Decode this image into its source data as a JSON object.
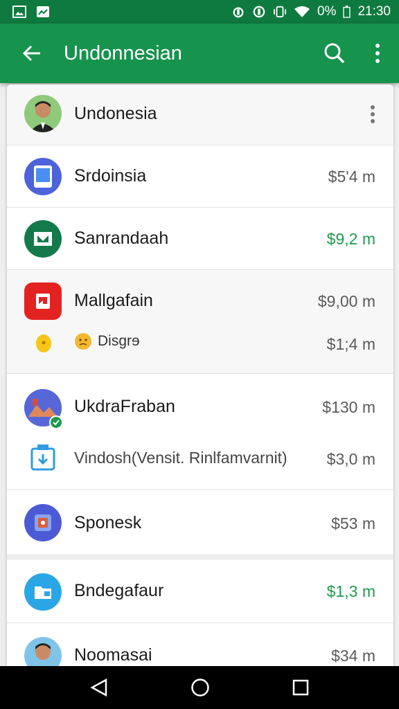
{
  "status_bar": {
    "battery_text": "0%",
    "time": "21:30"
  },
  "app_bar": {
    "title": "Undonnesian"
  },
  "header_row": {
    "name": "Undonesia"
  },
  "rows": [
    {
      "name": "Srdoinsia",
      "amount": "$5'4 m",
      "amount_color": "#5a5a5a"
    },
    {
      "name": "Sanrandaah",
      "amount": "$9,2 m",
      "amount_color": "#1d9a4e"
    },
    {
      "name": "Mallgafain",
      "amount": "$9,00 m",
      "sub_label": "Disgrɘ",
      "sub_amount": "$1;4 m"
    },
    {
      "name": "UkdraFraban",
      "amount": "$130 m",
      "sub_label": "Vindosh(Vensit. Rinlfamvarnit)",
      "sub_amount": "$3,0 m"
    },
    {
      "name": "Sponesk",
      "amount": "$53 m"
    },
    {
      "name": "Bndegafaur",
      "amount": "$1,3 m",
      "amount_color": "#1d9a4e"
    },
    {
      "name": "Noomasai",
      "amount": "$34 m"
    }
  ],
  "icons": {
    "srdoinsia": "tablet-icon",
    "sanrandaah": "mail-icon",
    "mallgafain": "calendar-icon",
    "ukdrafraban": "landscape-icon",
    "vindosh": "download-box-icon",
    "sponesk": "photo-icon",
    "bndegafaur": "folder-icon"
  },
  "colors": {
    "app_bar": "#16934d",
    "status_bar": "#0f7a3f",
    "accent_amount": "#1d9a4e"
  }
}
